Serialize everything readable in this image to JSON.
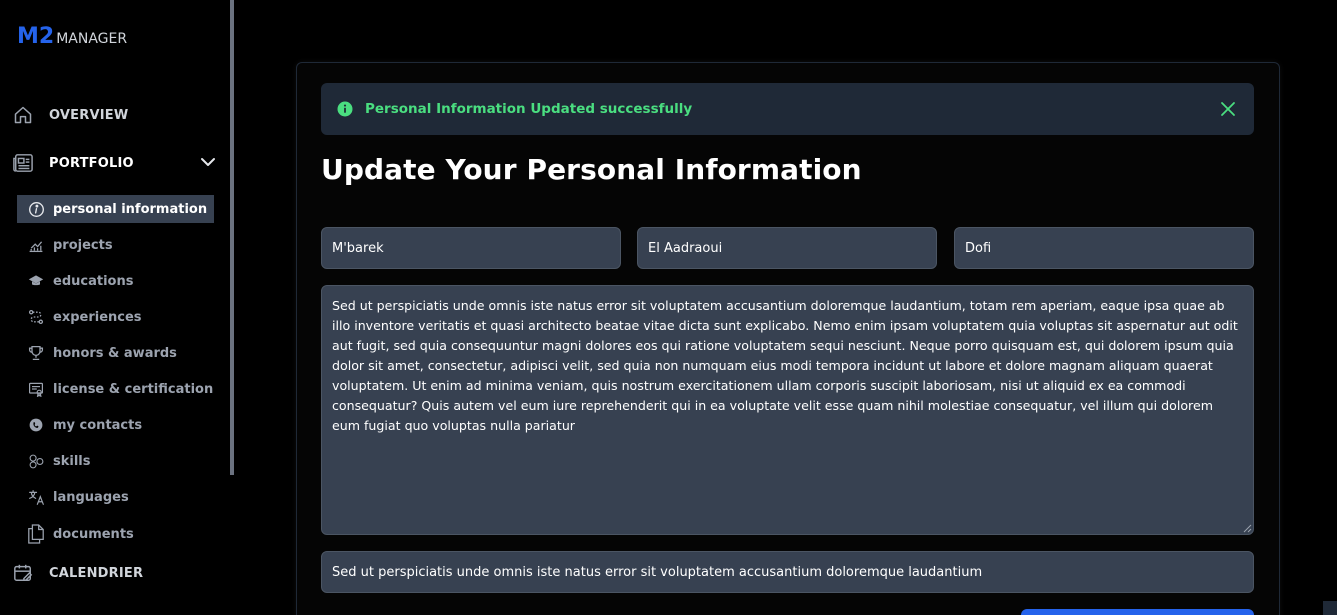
{
  "logo": {
    "mark": "M2",
    "text": "MANAGER"
  },
  "sidebar": {
    "items": [
      {
        "label": "OVERVIEW",
        "icon": "home-icon"
      },
      {
        "label": "PORTFOLIO",
        "icon": "newspaper-icon",
        "expanded": true
      },
      {
        "label": "CALENDRIER",
        "icon": "calendar-icon"
      }
    ],
    "portfolio_items": [
      {
        "label": "personal information",
        "icon": "info-icon",
        "active": true
      },
      {
        "label": "projects",
        "icon": "chart-icon"
      },
      {
        "label": "educations",
        "icon": "graduation-cap-icon"
      },
      {
        "label": "experiences",
        "icon": "route-icon"
      },
      {
        "label": "honors & awards",
        "icon": "trophy-icon"
      },
      {
        "label": "license & certification",
        "icon": "certificate-icon"
      },
      {
        "label": "my contacts",
        "icon": "contact-icon"
      },
      {
        "label": "skills",
        "icon": "hexagons-icon"
      },
      {
        "label": "languages",
        "icon": "translate-icon"
      },
      {
        "label": "documents",
        "icon": "documents-icon"
      }
    ]
  },
  "alert": {
    "message": "Personal Information Updated successfully",
    "color": "#4ade80"
  },
  "form": {
    "title": "Update Your Personal Information",
    "first_name": "M'barek",
    "last_name": "El Aadraoui",
    "nickname": "Dofi",
    "bio": "Sed ut perspiciatis unde omnis iste natus error sit voluptatem accusantium doloremque laudantium, totam rem aperiam, eaque ipsa quae ab illo inventore veritatis et quasi architecto beatae vitae dicta sunt explicabo. Nemo enim ipsam voluptatem quia voluptas sit aspernatur aut odit aut fugit, sed quia consequuntur magni dolores eos qui ratione voluptatem sequi nesciunt. Neque porro quisquam est, qui dolorem ipsum quia dolor sit amet, consectetur, adipisci velit, sed quia non numquam eius modi tempora incidunt ut labore et dolore magnam aliquam quaerat voluptatem. Ut enim ad minima veniam, quis nostrum exercitationem ullam corporis suscipit laboriosam, nisi ut aliquid ex ea commodi consequatur? Quis autem vel eum iure reprehenderit qui in ea voluptate velit esse quam nihil molestiae consequatur, vel illum qui dolorem eum fugiat quo voluptas nulla pariatur",
    "headline": "Sed ut perspiciatis unde omnis iste natus error sit voluptatem accusantium doloremque laudantium"
  },
  "colors": {
    "accent": "#2563eb",
    "background": "#000000",
    "field_bg": "#374151",
    "success": "#4ade80"
  }
}
